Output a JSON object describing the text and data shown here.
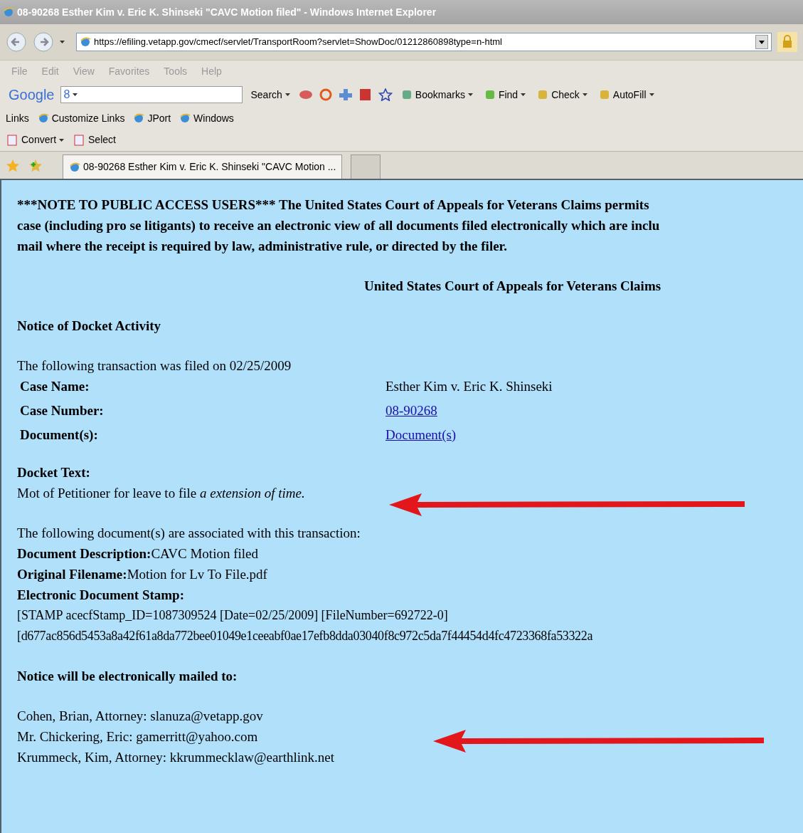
{
  "window": {
    "title": "08-90268 Esther Kim v. Eric K. Shinseki \"CAVC Motion filed\" - Windows Internet Explorer"
  },
  "address_bar": {
    "url": "https://efiling.vetapp.gov/cmecf/servlet/TransportRoom?servlet=ShowDoc/01212860898type=n-html"
  },
  "menu": [
    "File",
    "Edit",
    "View",
    "Favorites",
    "Tools",
    "Help"
  ],
  "google_toolbar": {
    "logo": "Google",
    "search_value": "8",
    "items": [
      {
        "kind": "button",
        "label": "Search"
      },
      {
        "kind": "icons"
      },
      {
        "kind": "button",
        "label": "Bookmarks"
      },
      {
        "kind": "button",
        "label": "Find"
      },
      {
        "kind": "button",
        "label": "Check"
      },
      {
        "kind": "button",
        "label": "AutoFill"
      }
    ]
  },
  "links_bar": {
    "label": "Links",
    "items": [
      "Customize Links",
      "JPort",
      "Windows"
    ]
  },
  "convert_bar": {
    "items": [
      "Convert",
      "Select"
    ]
  },
  "tabs": [
    {
      "label": "08-90268 Esther Kim v. Eric K. Shinseki \"CAVC Motion ...",
      "selected": true
    }
  ],
  "page": {
    "notice_lines": [
      "***NOTE TO PUBLIC ACCESS USERS*** The United States Court of Appeals for Veterans Claims permits",
      "case (including pro se litigants) to receive an electronic view of all documents filed electronically which are inclu",
      "mail where the receipt is required by law, administrative rule, or directed by the filer."
    ],
    "court": "United States Court of Appeals for Veterans Claims",
    "heading": "Notice of Docket Activity",
    "filed_line": "The following transaction was filed on 02/25/2009",
    "fields": [
      {
        "label": "Case Name:",
        "value": "Esther Kim v. Eric K. Shinseki",
        "kind": "text"
      },
      {
        "label": "Case Number:",
        "value": "08-90268",
        "kind": "link"
      },
      {
        "label": "Document(s):",
        "value": "Document(s)",
        "kind": "link"
      }
    ],
    "docket_label": "Docket Text:",
    "docket_text": "Mot of Petitioner for leave to file *a extension of time.*",
    "assoc_line": "The following document(s) are associated with this transaction:",
    "doc_lines": [
      {
        "label": "Document Description:",
        "value": "CAVC Motion filed"
      },
      {
        "label": "Original Filename:",
        "value": "Motion for Lv To File.pdf"
      },
      {
        "label": "Electronic Document Stamp:"
      }
    ],
    "stamp_lines": [
      "[STAMP acecfStamp_ID=1087309524 [Date=02/25/2009] [FileNumber=692722-0]",
      "[d677ac856d5453a8a42f61a8da772bee01049e1ceeabf0ae17efb8dda03040f8c972c5da7f44454d4fc4723368fa53322a"
    ],
    "mailed_heading": "Notice will be electronically mailed to:",
    "recipients": [
      "Cohen, Brian, Attorney: slanuza@vetapp.gov",
      "Mr. Chickering, Eric: gamerritt@yahoo.com",
      "Krummeck, Kim, Attorney: kkrummecklaw@earthlink.net"
    ]
  }
}
